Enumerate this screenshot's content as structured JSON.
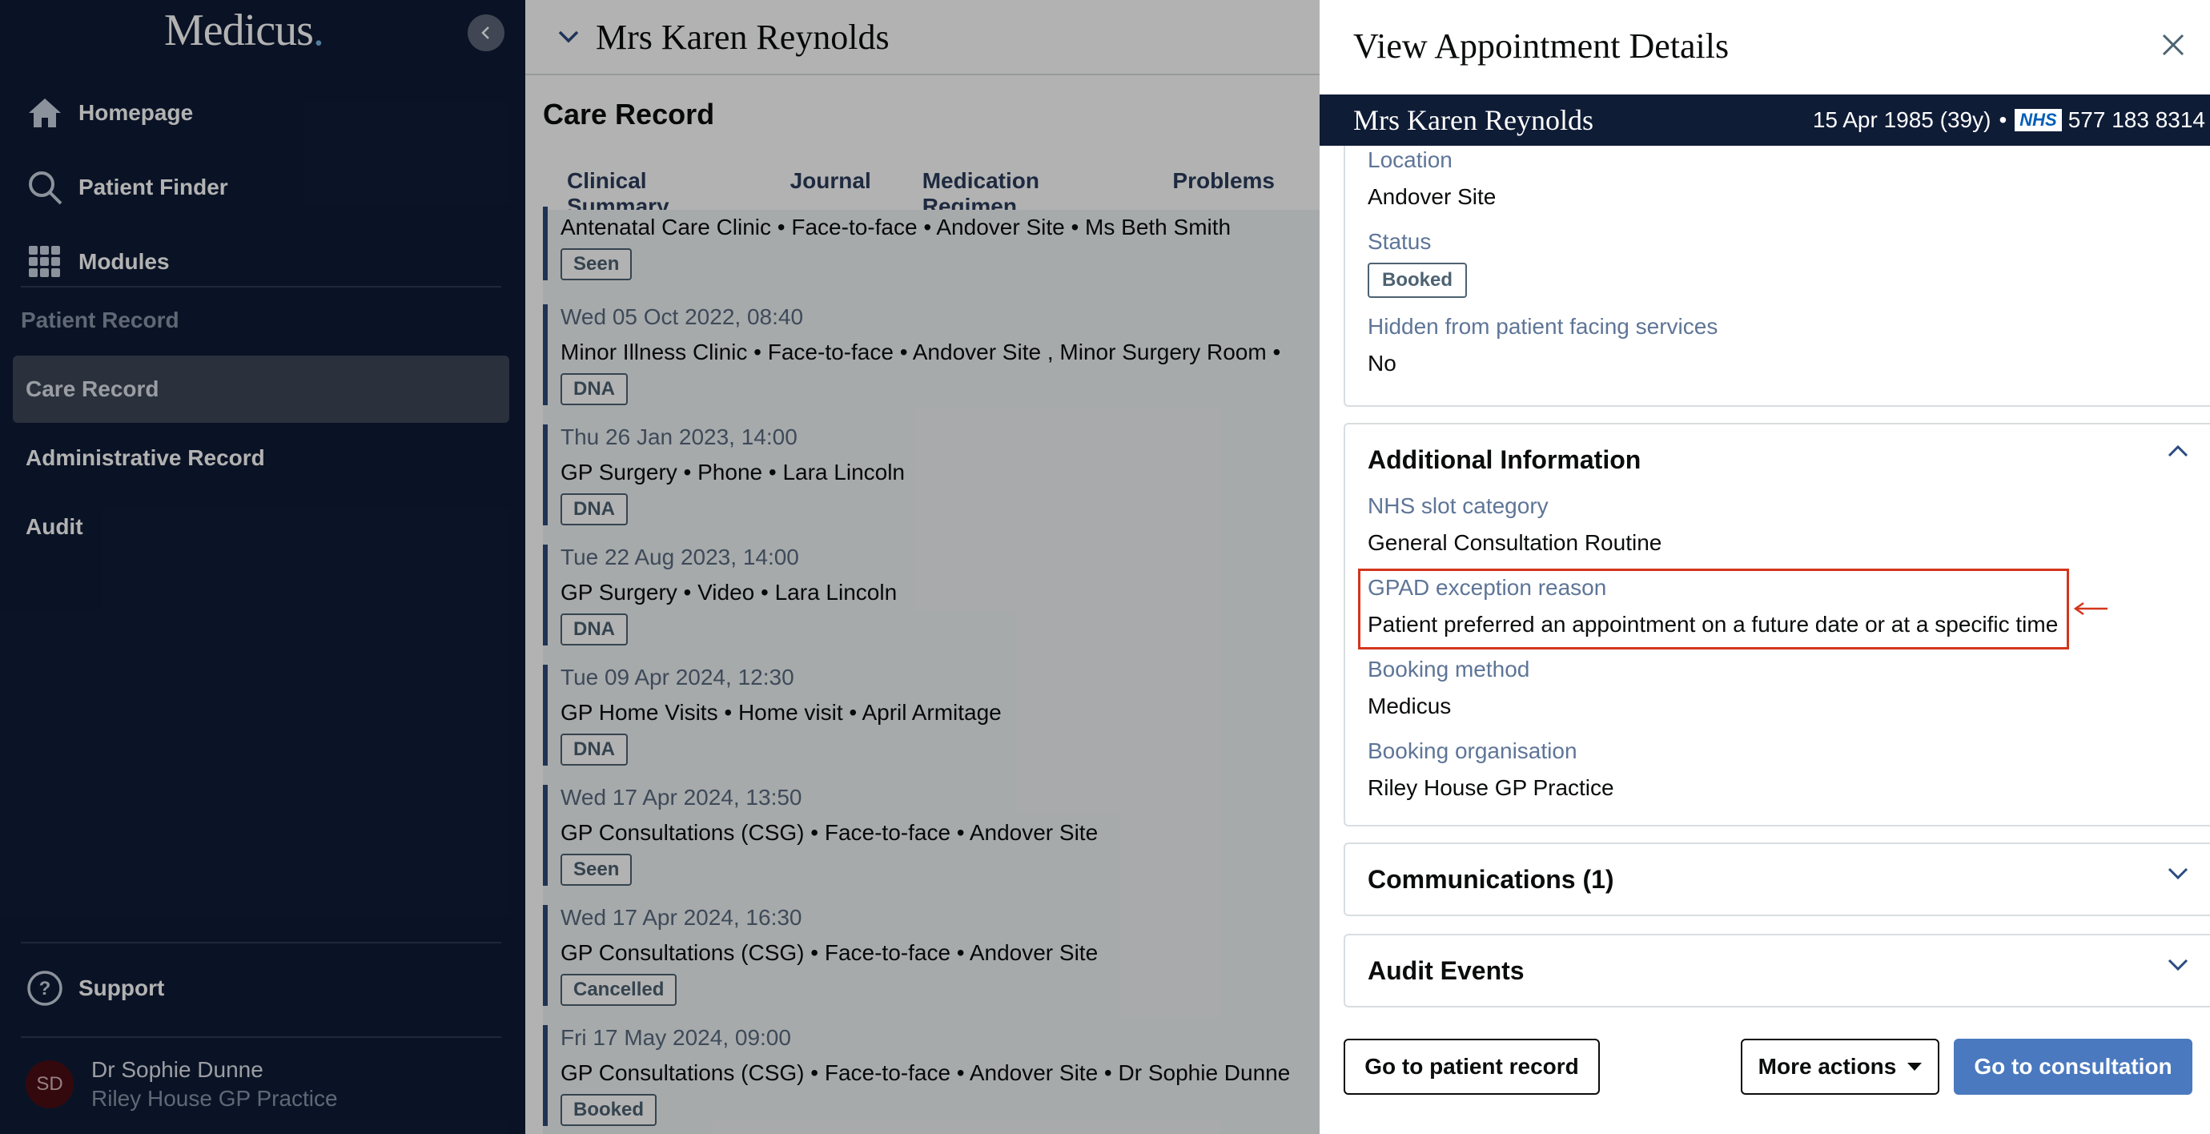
{
  "sidebar": {
    "logo": "Medicus",
    "logo_dot": ".",
    "nav": [
      {
        "label": "Homepage",
        "icon": "home-icon"
      },
      {
        "label": "Patient Finder",
        "icon": "search-icon"
      },
      {
        "label": "Modules",
        "icon": "grid-icon"
      }
    ],
    "section_label": "Patient Record",
    "sub_items": [
      {
        "label": "Care Record",
        "active": true
      },
      {
        "label": "Administrative Record",
        "active": false
      },
      {
        "label": "Audit",
        "active": false
      }
    ],
    "support": "Support",
    "user": {
      "initials": "SD",
      "name": "Dr Sophie Dunne",
      "org": "Riley House GP Practice"
    }
  },
  "main": {
    "patient_name": "Mrs Karen Reynolds",
    "page_title": "Care Record",
    "tabs": [
      "Clinical Summary",
      "Journal",
      "Medication Regimen",
      "Problems"
    ],
    "entries": [
      {
        "date": "",
        "detail": "Antenatal Care Clinic • Face-to-face • Andover Site  • Ms Beth Smith",
        "badge": "Seen"
      },
      {
        "date": "Wed 05 Oct 2022, 08:40",
        "detail": "Minor Illness Clinic • Face-to-face • Andover Site , Minor Surgery Room •",
        "badge": "DNA"
      },
      {
        "date": "Thu 26 Jan 2023, 14:00",
        "detail": "GP Surgery • Phone • Lara Lincoln",
        "badge": "DNA"
      },
      {
        "date": "Tue 22 Aug 2023, 14:00",
        "detail": "GP Surgery • Video • Lara Lincoln",
        "badge": "DNA"
      },
      {
        "date": "Tue 09 Apr 2024, 12:30",
        "detail": "GP Home Visits • Home visit • April Armitage",
        "badge": "DNA"
      },
      {
        "date": "Wed 17 Apr 2024, 13:50",
        "detail": "GP Consultations (CSG) • Face-to-face • Andover Site",
        "badge": "Seen"
      },
      {
        "date": "Wed 17 Apr 2024, 16:30",
        "detail": "GP Consultations (CSG) • Face-to-face • Andover Site",
        "badge": "Cancelled"
      },
      {
        "date": "Fri 17 May 2024, 09:00",
        "detail": "GP Consultations (CSG) • Face-to-face • Andover Site  • Dr Sophie Dunne",
        "badge": "Booked"
      }
    ]
  },
  "panel": {
    "title": "View Appointment Details",
    "banner": {
      "name": "Mrs Karen Reynolds",
      "dob": "15 Apr 1985 (39y)",
      "separator": "•",
      "nhs_label": "NHS",
      "nhs_number": "577 183 8314"
    },
    "details": {
      "location_label": "Location",
      "location_value": "Andover Site",
      "status_label": "Status",
      "status_value": "Booked",
      "hidden_label": "Hidden from patient facing services",
      "hidden_value": "No"
    },
    "additional": {
      "title": "Additional Information",
      "slot_label": "NHS slot category",
      "slot_value": "General Consultation Routine",
      "gpad_label": "GPAD exception reason",
      "gpad_value": "Patient preferred an appointment on a future date or at a specific time",
      "method_label": "Booking method",
      "method_value": "Medicus",
      "org_label": "Booking organisation",
      "org_value": "Riley House GP Practice"
    },
    "communications_title": "Communications (1)",
    "audit_title": "Audit Events",
    "buttons": {
      "patient_record": "Go to patient record",
      "more_actions": "More actions",
      "consultation": "Go to consultation"
    }
  },
  "colors": {
    "sidebar_bg": "#0f1c36",
    "primary": "#4a79bf",
    "highlight": "#d4351c",
    "label": "#5e7597"
  }
}
